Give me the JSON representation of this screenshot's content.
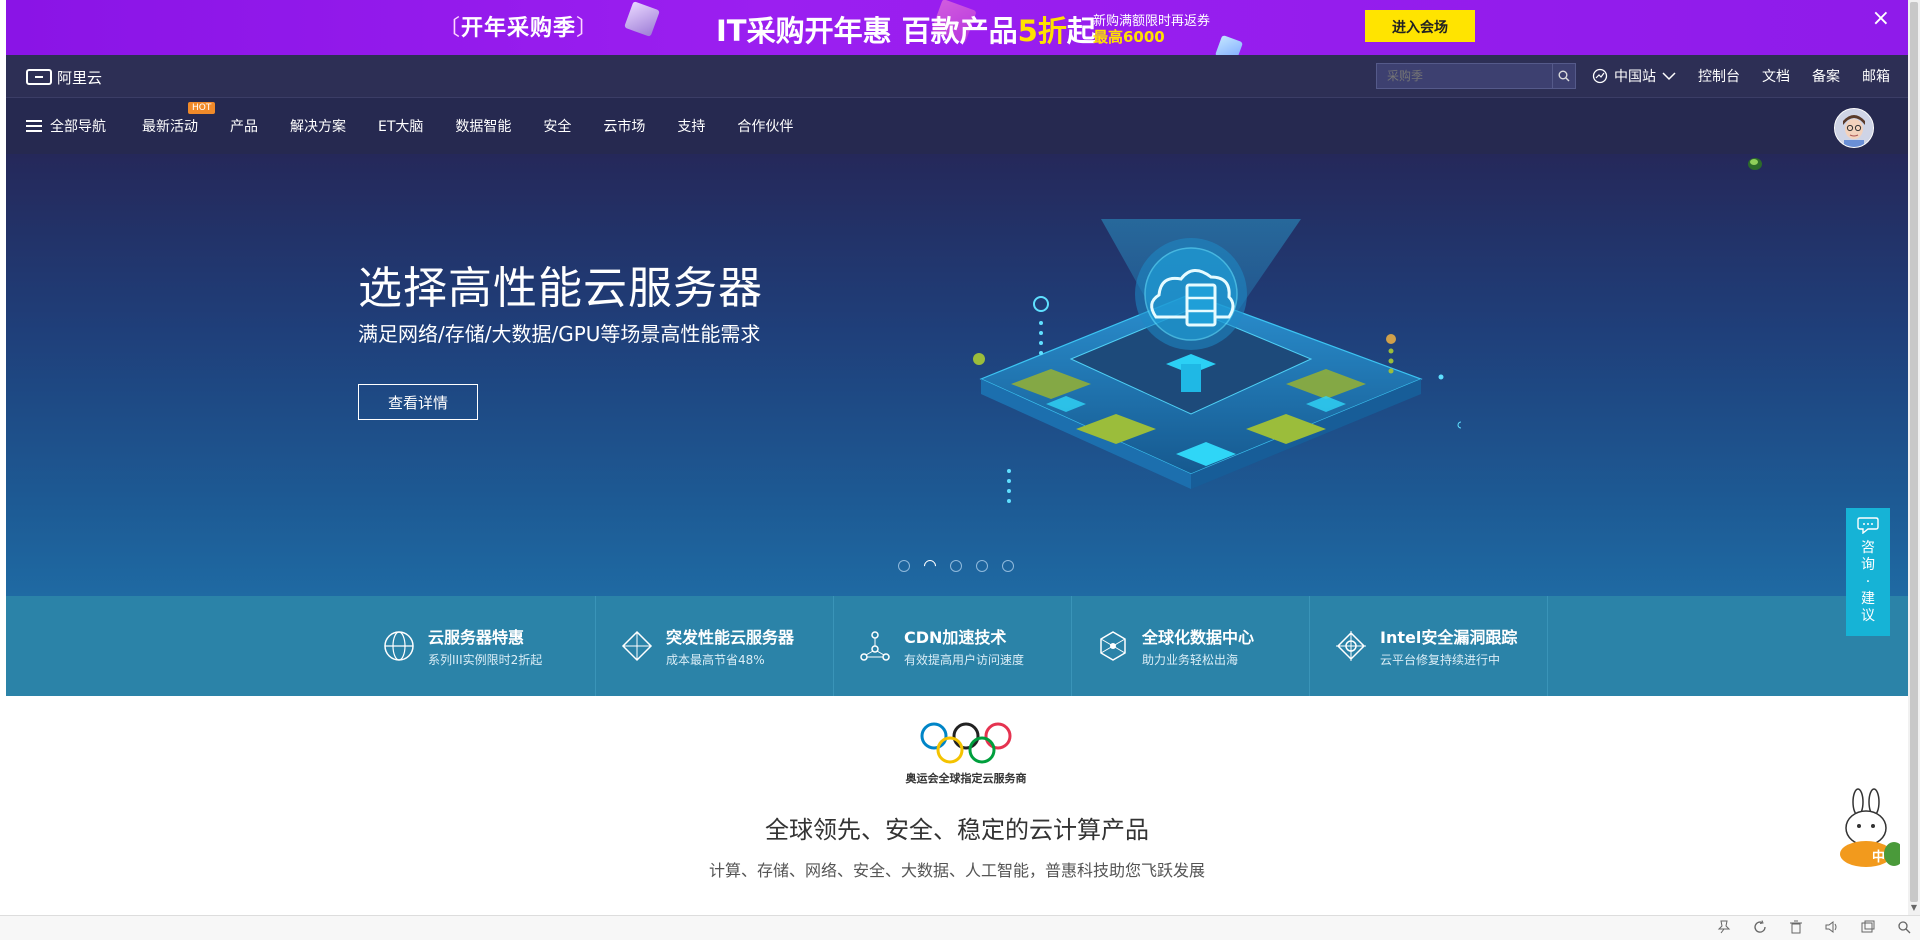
{
  "promo": {
    "brand_text": "开年采购季",
    "headline_prefix": "IT采购开年惠  百款产品",
    "headline_highlight": "5折",
    "headline_suffix": "起",
    "sub_line1": "新购满额限时再返券",
    "sub_line2": "最高6000",
    "enter_button": "进入会场",
    "close_icon": "×",
    "bg_color": "#8a14e6",
    "accent_color": "#ffe400"
  },
  "topbar": {
    "logo_text": "阿里云",
    "search_placeholder": "采购季",
    "region_label": "中国站",
    "links": [
      "控制台",
      "文档",
      "备案",
      "邮箱"
    ]
  },
  "mainnav": {
    "all_nav": "全部导航",
    "hot_badge": "HOT",
    "items": [
      "最新活动",
      "产品",
      "解决方案",
      "ET大脑",
      "数据智能",
      "安全",
      "云市场",
      "支持",
      "合作伙伴"
    ]
  },
  "hero": {
    "title": "选择高性能云服务器",
    "subtitle": "满足网络/存储/大数据/GPU等场景高性能需求",
    "button": "查看详情",
    "slides_count": 5,
    "active_slide": 2
  },
  "features": [
    {
      "title": "云服务器特惠",
      "sub": "系列III实例限时2折起",
      "icon": "globe-icon"
    },
    {
      "title": "突发性能云服务器",
      "sub": "成本最高节省48%",
      "icon": "diamond-icon"
    },
    {
      "title": "CDN加速技术",
      "sub": "有效提高用户访问速度",
      "icon": "network-icon"
    },
    {
      "title": "全球化数据中心",
      "sub": "助力业务轻松出海",
      "icon": "hexagon-icon"
    },
    {
      "title": "Intel安全漏洞跟踪",
      "sub": "云平台修复持续进行中",
      "icon": "crosshair-icon"
    }
  ],
  "olympic": {
    "caption": "奥运会全球指定云服务商"
  },
  "section": {
    "title": "全球领先、安全、稳定的云计算产品",
    "subtitle": "计算、存储、网络、安全、大数据、人工智能，普惠科技助您飞跃发展"
  },
  "consult": {
    "label_lines": [
      "咨",
      "询",
      "·",
      "建",
      "议"
    ]
  },
  "mascot": {
    "label": "中"
  }
}
